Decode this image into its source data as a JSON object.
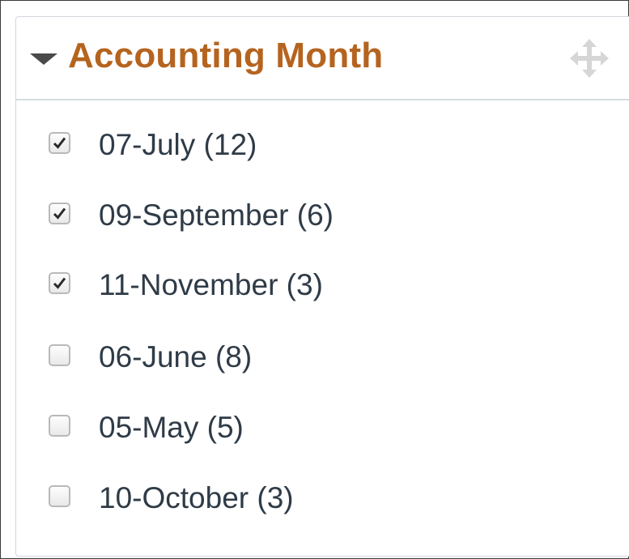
{
  "panel": {
    "title": "Accounting Month",
    "collapse_icon": "caret-down-icon",
    "move_icon": "move-arrows-icon"
  },
  "colors": {
    "title": "#b5641f",
    "label": "#2f3b47",
    "border": "#d2d6dc"
  },
  "items": [
    {
      "label": "07-July (12)",
      "checked": true
    },
    {
      "label": "09-September (6)",
      "checked": true
    },
    {
      "label": "11-November (3)",
      "checked": true
    },
    {
      "label": "06-June (8)",
      "checked": false
    },
    {
      "label": "05-May (5)",
      "checked": false
    },
    {
      "label": "10-October (3)",
      "checked": false
    }
  ]
}
